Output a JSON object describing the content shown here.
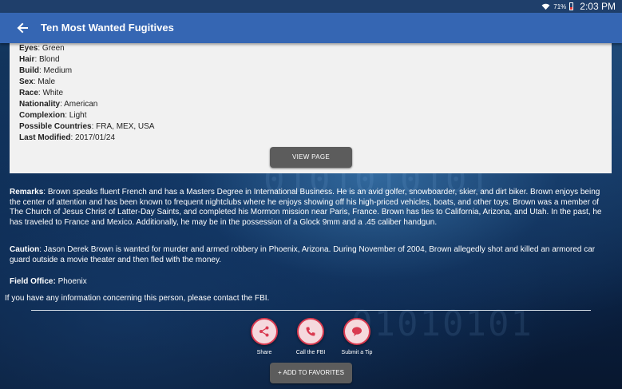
{
  "status": {
    "battery_pct": "71%",
    "time": "2:03 PM"
  },
  "appbar": {
    "title": "Ten Most Wanted Fugitives"
  },
  "details": [
    {
      "label": "Eyes",
      "value": ": Green"
    },
    {
      "label": "Hair",
      "value": ": Blond"
    },
    {
      "label": "Build",
      "value": ": Medium"
    },
    {
      "label": "Sex",
      "value": ": Male"
    },
    {
      "label": "Race",
      "value": ": White"
    },
    {
      "label": "Nationality",
      "value": ": American"
    },
    {
      "label": "Complexion",
      "value": ": Light"
    },
    {
      "label": "Possible Countries",
      "value": ": FRA, MEX, USA"
    },
    {
      "label": "Last Modified",
      "value": ": 2017/01/24"
    }
  ],
  "view_page_label": "VIEW PAGE",
  "remarks": {
    "label": "Remarks",
    "text": ": Brown speaks fluent French and has a Masters Degree in International Business. He is an avid golfer, snowboarder, skier, and dirt biker. Brown enjoys being the center of attention and has been known to frequent nightclubs where he enjoys showing off his high-priced vehicles, boats, and other toys. Brown was a member of The Church of Jesus Christ of Latter-Day Saints, and completed his Mormon mission near Paris, France.   Brown has ties to California, Arizona, and Utah. In the past, he has traveled to France and Mexico. Additionally, he may be in the possession of a Glock 9mm and a .45 caliber handgun."
  },
  "caution": {
    "label": "Caution",
    "text": ": Jason Derek Brown is wanted for murder and armed robbery in Phoenix, Arizona. During November of 2004, Brown allegedly shot and killed an armored car guard outside a movie theater and then fled with the money."
  },
  "field_office": {
    "label": "Field Office:",
    "value": " Phoenix"
  },
  "contact_text": "If you have any information concerning this person, please contact the FBI.",
  "actions": {
    "share": "Share",
    "call": "Call the FBI",
    "tip": "Submit a Tip"
  },
  "add_favorites_label": "+ ADD TO FAVORITES",
  "colors": {
    "appbar": "#3566b3",
    "accent_red": "#d93a50",
    "button_gray": "#5c5c5c"
  }
}
